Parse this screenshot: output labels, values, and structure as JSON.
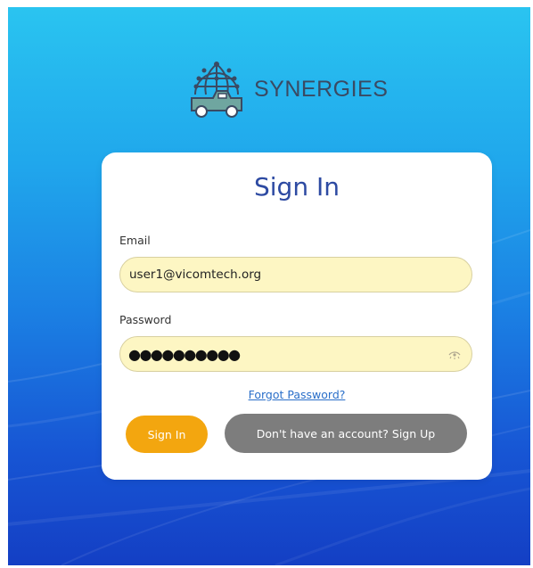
{
  "brand": {
    "name": "SYNERGIES",
    "logo_icon": "globe-network-truck-icon"
  },
  "signin_form": {
    "title": "Sign In",
    "email_label": "Email",
    "email_value": "user1@vicomtech.org",
    "password_label": "Password",
    "password_masked": "●●●●●●●●●●",
    "password_toggle_icon": "eye-toggle-icon",
    "forgot_password_link": "Forgot Password?",
    "signin_button": "Sign In",
    "signup_button": "Don't have an account? Sign Up"
  },
  "colors": {
    "background_top": "#2ac4f0",
    "background_bottom": "#143fc4",
    "title": "#2d4aa2",
    "input_fill": "#fdf6c3",
    "signin_button": "#f3a60f",
    "signup_button": "#7d7d7d",
    "link": "#2a6fc9"
  }
}
